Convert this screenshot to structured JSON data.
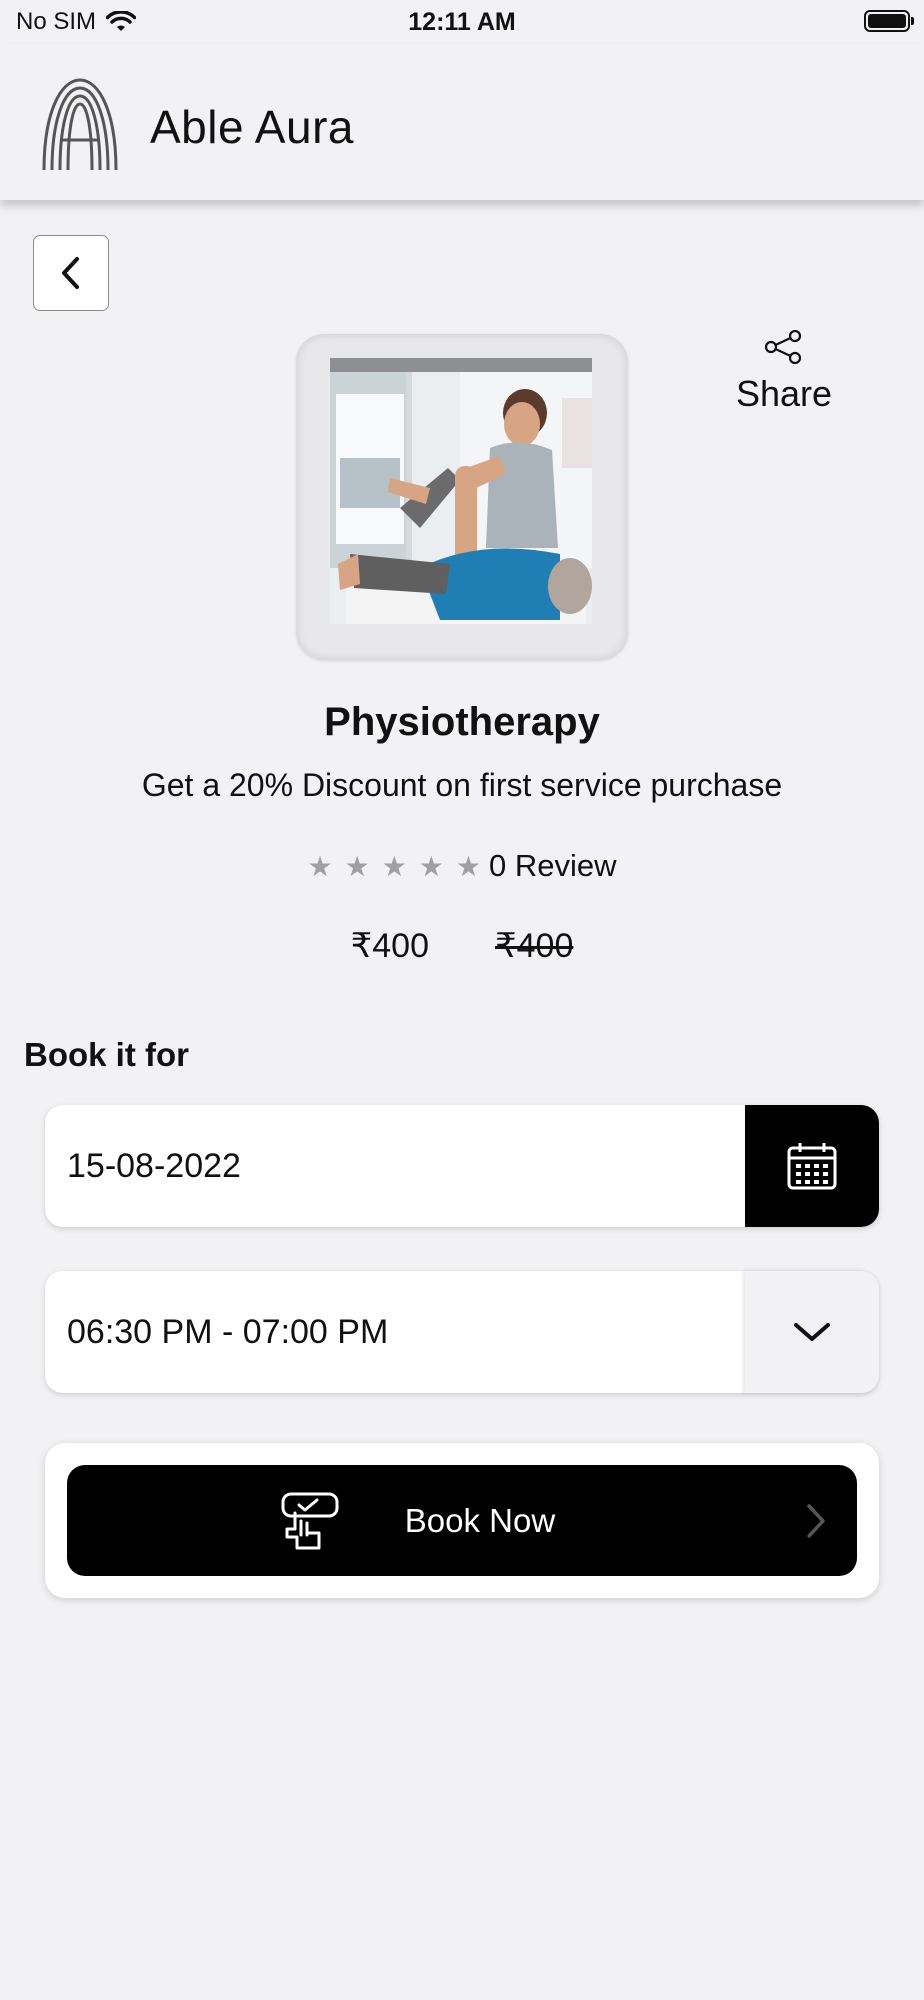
{
  "status_bar": {
    "carrier": "No SIM",
    "time": "12:11 AM"
  },
  "header": {
    "app_name": "Able Aura"
  },
  "service": {
    "name": "Physiotherapy",
    "promo": "Get a 20% Discount on first service purchase",
    "rating_stars": 0,
    "review_text": "0 Review",
    "price": "₹400",
    "original_price": "₹400",
    "share_label": "Share",
    "image_alt": "physiotherapist stretching patient leg"
  },
  "booking": {
    "section_label": "Book it for",
    "date_value": "15-08-2022",
    "time_slot": "06:30 PM - 07:00 PM",
    "book_button_label": "Book Now"
  },
  "icons": {
    "back": "chevron-left-icon",
    "share": "share-icon",
    "calendar": "calendar-icon",
    "dropdown": "chevron-down-icon",
    "book": "booking-hand-icon",
    "book_arrow": "chevron-right-icon"
  }
}
